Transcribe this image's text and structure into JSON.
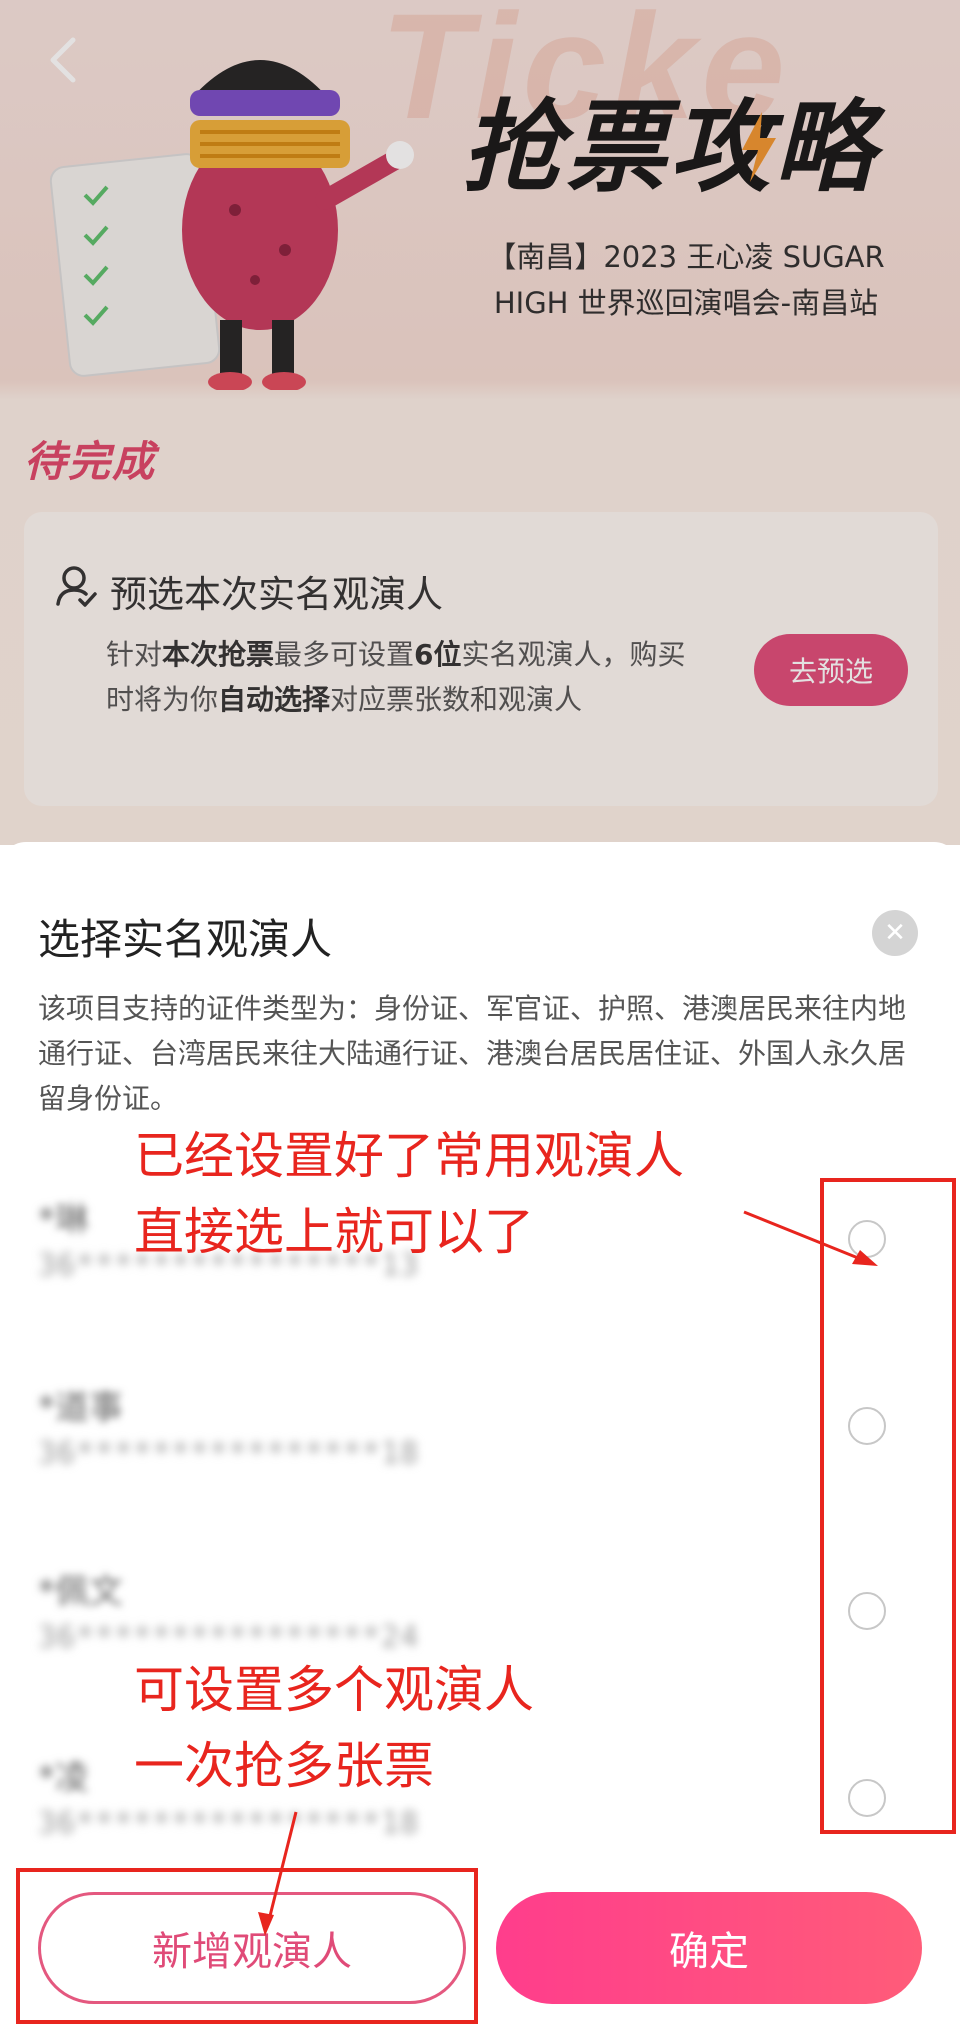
{
  "header": {
    "back_icon": "chevron-left-icon",
    "watermark_text": "Ticke",
    "hero_title": "抢票攻略",
    "hero_subtitle": "【南昌】2023 王心凌 SUGAR HIGH 世界巡回演唱会-南昌站"
  },
  "pending": {
    "section_title": "待完成",
    "task": {
      "icon": "user-check-icon",
      "title": "预选本次实名观演人",
      "desc_1": "针对",
      "desc_2": "本次抢票",
      "desc_3": "最多可设置",
      "desc_4": "6位",
      "desc_5": "实名观演人，购买时将为你",
      "desc_6": "自动选择",
      "desc_7": "对应票张数和观演人",
      "button_label": "去预选"
    }
  },
  "sheet": {
    "title": "选择实名观演人",
    "close_icon": "close-icon",
    "notice": "该项目支持的证件类型为：身份证、军官证、护照、港澳居民来往内地通行证、台湾居民来往大陆通行证、港澳台居民居住证、外国人永久居留身份证。",
    "viewers": [
      {
        "name": "*琳",
        "id": "36****************13",
        "selected": false
      },
      {
        "name": "*道事",
        "id": "36****************18",
        "selected": false
      },
      {
        "name": "*佩文",
        "id": "36****************24",
        "selected": false
      },
      {
        "name": "*凌",
        "id": "36****************18",
        "selected": false
      }
    ],
    "add_button": "新增观演人",
    "confirm_button": "确定"
  },
  "annotations": {
    "top_note_line1": "已经设置好了常用观演人",
    "top_note_line2": "直接选上就可以了",
    "bottom_note_line1": "可设置多个观演人",
    "bottom_note_line2": "一次抢多张票",
    "color": "#e8251e"
  },
  "colors": {
    "accent_pink": "#e04b78",
    "confirm_gradient_start": "#ff3d8c",
    "confirm_gradient_end": "#ff5c79"
  }
}
